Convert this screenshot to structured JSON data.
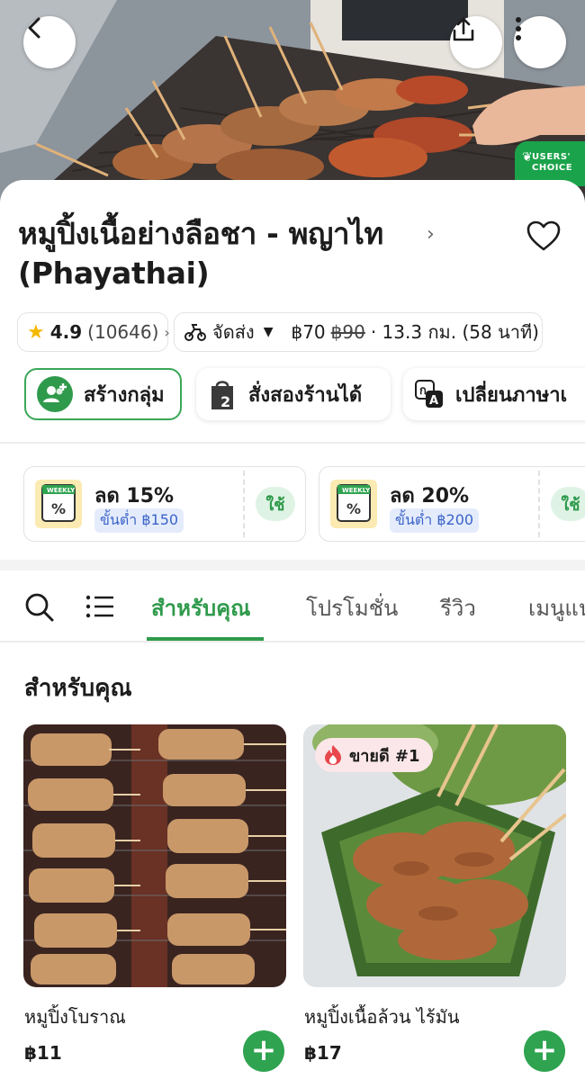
{
  "restaurant": {
    "name_line1": "หมูปิ้งเนื้อย่างลือชา - พญาไท",
    "name_line2": "(Phayathai)",
    "badge": "USERS' CHOICE"
  },
  "info": {
    "rating": "4.9",
    "reviews": "(10646)",
    "delivery_label": "จัดส่ง",
    "fee": "฿70",
    "fee_original": "฿90",
    "distance_time": "· 13.3 กม. (58 นาที)"
  },
  "actions": {
    "group": "สร้างกลุ่ม",
    "order_from_two": "สั่งสองร้านได้",
    "translate": "เปลี่ยนภาษาเ"
  },
  "vouchers": [
    {
      "tag": "WEEKLY",
      "title": "ลด 15%",
      "min": "ขั้นต่ำ ฿150",
      "use": "ใช้"
    },
    {
      "tag": "WEEKLY",
      "title": "ลด 20%",
      "min": "ขั้นต่ำ ฿200",
      "use": "ใช้"
    }
  ],
  "tabs": [
    "สำหรับคุณ",
    "โปรโมชั่น",
    "รีวิว",
    "เมนูแน"
  ],
  "section": {
    "title": "สำหรับคุณ"
  },
  "items": [
    {
      "name": "หมูปิ้งโบราณ",
      "price": "฿11"
    },
    {
      "name": "หมูปิ้งเนื้อล้วน ไร้มัน",
      "price": "฿17",
      "badge": "ขายดี #1"
    }
  ],
  "colors": {
    "accent": "#2f9a4c",
    "star": "#f5b800",
    "voucher_min": "#3b63c9"
  }
}
